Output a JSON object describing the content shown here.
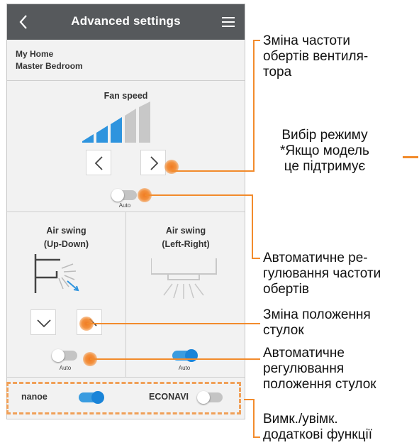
{
  "header": {
    "title": "Advanced settings",
    "back_icon": "chevron-left-icon",
    "menu_icon": "hamburger-menu-icon"
  },
  "location": {
    "home": "My Home",
    "room": "Master Bedroom"
  },
  "fan_speed": {
    "label": "Fan speed",
    "level": 3,
    "max_level": 5,
    "auto_label": "Auto",
    "auto_on": false
  },
  "air_swing_ud": {
    "label_line1": "Air swing",
    "label_line2": "(Up-Down)",
    "auto_label": "Auto",
    "auto_on": false
  },
  "air_swing_lr": {
    "label_line1": "Air swing",
    "label_line2": "(Left-Right)",
    "auto_label": "Auto",
    "auto_on": true
  },
  "options": {
    "nanoe_label": "nanoe",
    "nanoe_on": true,
    "econavi_label": "ECONAVI",
    "econavi_on": false
  },
  "colors": {
    "accent": "#1a84d8",
    "highlight": "#f28b2c",
    "header": "#56595c"
  },
  "annotations": {
    "fan_change": [
      "Зміна частоти",
      "обертів вентиля-",
      "тора"
    ],
    "mode_select": [
      "Вибір режиму",
      "*Якщо модель",
      "це підтримує"
    ],
    "auto_fan": [
      "Автоматичне ре-",
      "гулювання частоти",
      "обертів"
    ],
    "louver_change": [
      "Зміна положення",
      "стулок"
    ],
    "auto_louver": [
      "Автоматичне",
      "регулювання",
      "положення стулок"
    ],
    "extra": [
      "Вимк./увімк.",
      "додаткові функції"
    ]
  }
}
